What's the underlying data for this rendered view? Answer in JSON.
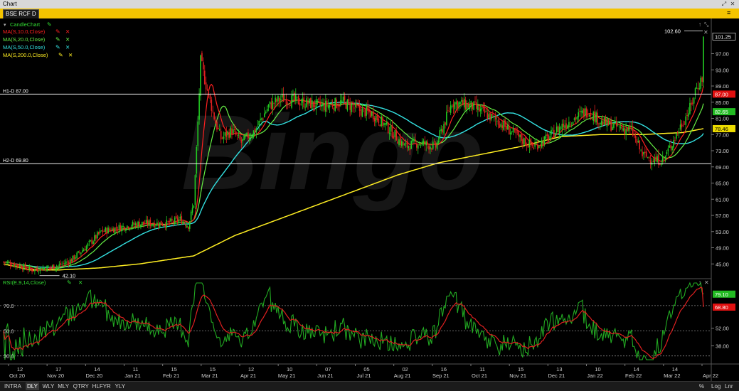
{
  "window": {
    "title": "Chart"
  },
  "symbol": {
    "label": "BSE RCF D"
  },
  "main_legend": {
    "title": "CandleChart",
    "items": [
      {
        "label": "MA(S,10.0,Close)",
        "color": "#ff2020"
      },
      {
        "label": "MA(S,20.0,Close)",
        "color": "#66ee44"
      },
      {
        "label": "MA(S,50.0,Close)",
        "color": "#33e0e0"
      },
      {
        "label": "MA(S,200.0,Close)",
        "color": "#ffee22"
      }
    ]
  },
  "rsi_legend": {
    "label": "RSI(E,9,14,Close)"
  },
  "watermark": "Bingo",
  "horizontal_lines": [
    {
      "label": "H1-D 87.00",
      "value": 87.0
    },
    {
      "label": "H2-D 69.80",
      "value": 69.8
    }
  ],
  "annotations": {
    "high": "102.60",
    "low": "42.10"
  },
  "price_badges": [
    {
      "text": "101.25",
      "color": "#ffffff",
      "value": 101.25
    },
    {
      "text": "87.00",
      "color": "#e01010",
      "value": 87.0
    },
    {
      "text": "82.65",
      "color": "#22bb22",
      "value": 82.65
    },
    {
      "text": "78.46",
      "color": "#eedd00",
      "value": 78.46
    }
  ],
  "rsi_badges": [
    {
      "text": "79.10",
      "color": "#22bb22",
      "value": 79.1
    },
    {
      "text": "68.80",
      "color": "#e01010",
      "value": 68.8
    }
  ],
  "bottom_bar": {
    "timeframes": [
      "INTRA",
      "DLY",
      "WLY",
      "MLY",
      "QTRY",
      "HLFYR",
      "YLY"
    ],
    "active": "DLY",
    "options": [
      "%",
      "Log",
      "Lnr"
    ]
  },
  "chart_data": [
    {
      "type": "candlestick",
      "title": "BSE RCF D",
      "ylim": [
        41,
        105
      ],
      "y_ticks": [
        45.0,
        49.0,
        53.0,
        57.0,
        61.0,
        65.0,
        69.0,
        73.0,
        77.0,
        81.0,
        85.0,
        89.0,
        93.0,
        97.0
      ],
      "y_tick_labels": [
        "45.00",
        "49.00",
        "53.00",
        "57.00",
        "61.00",
        "65.00",
        "69.00",
        "73.00",
        "77.00",
        "81.00",
        "85.00",
        "89.00",
        "93.00",
        "97.00"
      ],
      "x_ticks": [
        {
          "day": "12",
          "month": "Oct 20"
        },
        {
          "day": "17",
          "month": "Nov 20"
        },
        {
          "day": "14",
          "month": "Dec 20"
        },
        {
          "day": "11",
          "month": "Jan 21"
        },
        {
          "day": "15",
          "month": "Feb 21"
        },
        {
          "day": "15",
          "month": "Mar 21"
        },
        {
          "day": "12",
          "month": "Apr 21"
        },
        {
          "day": "10",
          "month": "May 21"
        },
        {
          "day": "07",
          "month": "Jun 21"
        },
        {
          "day": "05",
          "month": "Jul 21"
        },
        {
          "day": "02",
          "month": "Aug 21"
        },
        {
          "day": "16",
          "month": "Sep 21"
        },
        {
          "day": "11",
          "month": "Oct 21"
        },
        {
          "day": "15",
          "month": "Nov 21"
        },
        {
          "day": "13",
          "month": "Dec 21"
        },
        {
          "day": "10",
          "month": "Jan 22"
        },
        {
          "day": "14",
          "month": "Feb 22"
        },
        {
          "day": "14",
          "month": "Mar 22"
        },
        {
          "day": "",
          "month": "Apr 22"
        }
      ],
      "price_path": [
        [
          0,
          45.5
        ],
        [
          12,
          44.5
        ],
        [
          20,
          43.5
        ],
        [
          30,
          44
        ],
        [
          40,
          44.5
        ],
        [
          50,
          46
        ],
        [
          60,
          49
        ],
        [
          72,
          53
        ],
        [
          85,
          54
        ],
        [
          100,
          55
        ],
        [
          120,
          55
        ],
        [
          130,
          56
        ],
        [
          136,
          54.5
        ],
        [
          140,
          60
        ],
        [
          143,
          80
        ],
        [
          145,
          95
        ],
        [
          150,
          88
        ],
        [
          156,
          80
        ],
        [
          160,
          76
        ],
        [
          168,
          78
        ],
        [
          175,
          75
        ],
        [
          185,
          78
        ],
        [
          195,
          84
        ],
        [
          205,
          86
        ],
        [
          220,
          85
        ],
        [
          235,
          84
        ],
        [
          250,
          85
        ],
        [
          262,
          83
        ],
        [
          272,
          82
        ],
        [
          285,
          78
        ],
        [
          295,
          74
        ],
        [
          305,
          75
        ],
        [
          318,
          74
        ],
        [
          330,
          85
        ],
        [
          345,
          84
        ],
        [
          355,
          82
        ],
        [
          365,
          80
        ],
        [
          380,
          76
        ],
        [
          390,
          74
        ],
        [
          400,
          76
        ],
        [
          410,
          79
        ],
        [
          420,
          81
        ],
        [
          430,
          83
        ],
        [
          440,
          80
        ],
        [
          450,
          79
        ],
        [
          462,
          78
        ],
        [
          470,
          72
        ],
        [
          480,
          70.5
        ],
        [
          486,
          71
        ],
        [
          492,
          75
        ],
        [
          498,
          79
        ],
        [
          506,
          84
        ],
        [
          509,
          88
        ],
        [
          515,
          91.5
        ]
      ],
      "moving_averages": [
        {
          "name": "MA(S,10.0,Close)",
          "color": "#ff2020",
          "window": 10
        },
        {
          "name": "MA(S,20.0,Close)",
          "color": "#66ee44",
          "window": 20
        },
        {
          "name": "MA(S,50.0,Close)",
          "color": "#33e0e0",
          "window": 50
        },
        {
          "name": "MA(S,200.0,Close)",
          "color": "#ffee22",
          "window": 200
        }
      ],
      "ma200_path": [
        [
          0,
          45
        ],
        [
          20,
          43.5
        ],
        [
          40,
          43.5
        ],
        [
          70,
          44
        ],
        [
          100,
          45
        ],
        [
          140,
          47
        ],
        [
          170,
          52
        ],
        [
          210,
          57
        ],
        [
          250,
          62
        ],
        [
          290,
          67
        ],
        [
          320,
          70
        ],
        [
          350,
          72
        ],
        [
          380,
          74
        ],
        [
          410,
          76.5
        ],
        [
          440,
          77
        ],
        [
          470,
          77
        ],
        [
          500,
          77.5
        ],
        [
          515,
          78.46
        ]
      ]
    },
    {
      "type": "line",
      "title": "RSI(E,9,14,Close)",
      "ylim": [
        27,
        88
      ],
      "y_ticks": [
        30.0,
        50.0,
        70.0
      ],
      "y_tick_labels": [
        "30.0",
        "50.0",
        "70.0"
      ],
      "right_ticks": [
        38.0,
        52.0
      ],
      "right_tick_labels": [
        "38.00",
        "52.00"
      ],
      "levels": [
        30,
        50,
        70
      ]
    }
  ]
}
